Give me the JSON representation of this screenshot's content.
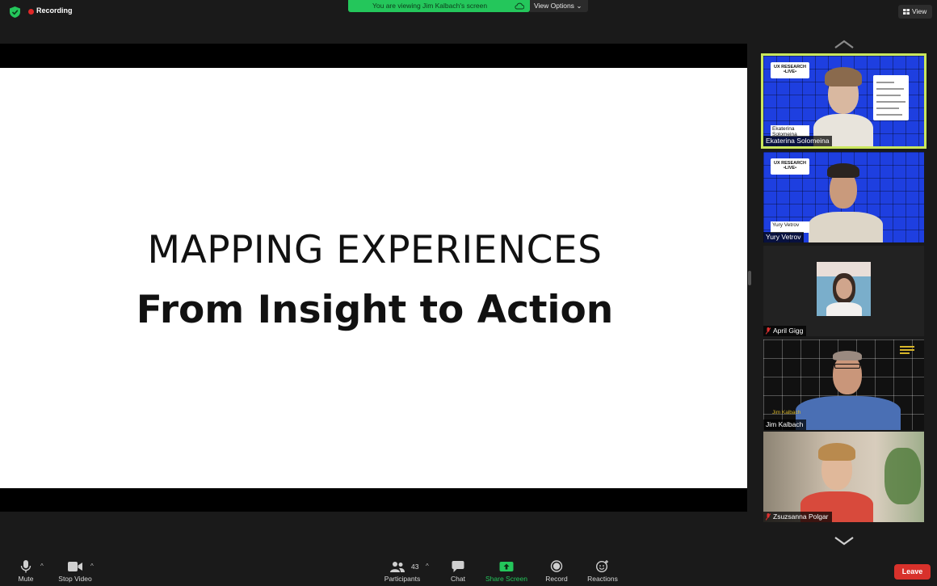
{
  "topbar": {
    "recording_label": "Recording",
    "viewing_banner": "You are viewing Jim Kalbach's screen",
    "view_options_label": "View Options",
    "view_button_label": "View"
  },
  "slide": {
    "title": "MAPPING EXPERIENCES",
    "subtitle": "From Insight to Action"
  },
  "gallery": {
    "tiles": [
      {
        "name": "Ekaterina Solomeina",
        "badge": "UX RESEARCH\n•LIVE•",
        "lower_label": "Ekaterina Solomeina",
        "active": true,
        "muted": false
      },
      {
        "name": "Yury Vetrov",
        "badge": "UX RESEARCH\n•LIVE•",
        "lower_label": "Yury Vetrov",
        "active": false,
        "muted": false
      },
      {
        "name": "April Gigg",
        "active": false,
        "muted": true
      },
      {
        "name": "Jim Kalbach",
        "lower_label": "Jim Kalbach",
        "active": false,
        "muted": false
      },
      {
        "name": "Zsuzsanna Polgar",
        "active": false,
        "muted": true
      }
    ]
  },
  "toolbar": {
    "mute_label": "Mute",
    "stop_video_label": "Stop Video",
    "participants_label": "Participants",
    "participants_count": "43",
    "chat_label": "Chat",
    "share_screen_label": "Share Screen",
    "record_label": "Record",
    "reactions_label": "Reactions",
    "leave_label": "Leave"
  },
  "colors": {
    "accent_green": "#24c65b",
    "active_speaker_outline": "#c9e65c",
    "leave_red": "#d8312b",
    "recording_red": "#e02828"
  }
}
